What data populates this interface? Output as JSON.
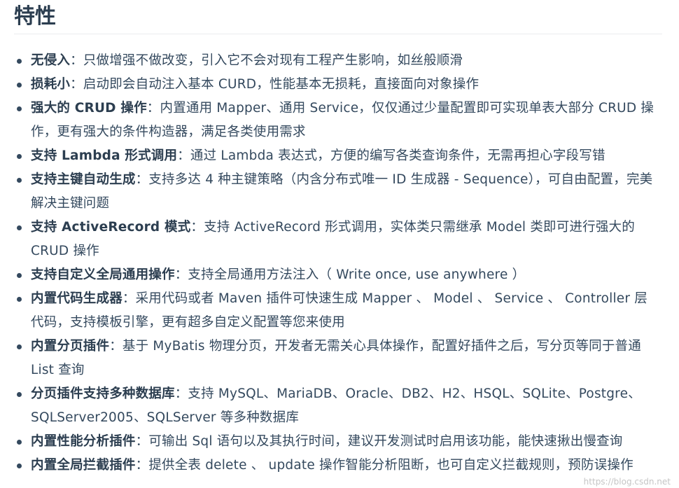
{
  "heading": "特性",
  "features": [
    {
      "name": "无侵入",
      "sep": "：",
      "desc": "只做增强不做改变，引入它不会对现有工程产生影响，如丝般顺滑"
    },
    {
      "name": "损耗小",
      "sep": "：",
      "desc": "启动即会自动注入基本 CURD，性能基本无损耗，直接面向对象操作"
    },
    {
      "name": "强大的 CRUD 操作",
      "sep": "：",
      "desc": "内置通用 Mapper、通用 Service，仅仅通过少量配置即可实现单表大部分 CRUD 操作，更有强大的条件构造器，满足各类使用需求"
    },
    {
      "name": "支持 Lambda 形式调用",
      "sep": "：",
      "desc": "通过 Lambda 表达式，方便的编写各类查询条件，无需再担心字段写错"
    },
    {
      "name": "支持主键自动生成",
      "sep": "：",
      "desc": "支持多达 4 种主键策略（内含分布式唯一 ID 生成器 - Sequence），可自由配置，完美解决主键问题"
    },
    {
      "name": "支持 ActiveRecord 模式",
      "sep": "：",
      "desc": "支持 ActiveRecord 形式调用，实体类只需继承 Model 类即可进行强大的 CRUD 操作"
    },
    {
      "name": "支持自定义全局通用操作",
      "sep": "：",
      "desc": "支持全局通用方法注入（ Write once, use anywhere ）"
    },
    {
      "name": "内置代码生成器",
      "sep": "：",
      "desc": "采用代码或者 Maven 插件可快速生成 Mapper 、 Model 、 Service 、 Controller 层代码，支持模板引擎，更有超多自定义配置等您来使用"
    },
    {
      "name": "内置分页插件",
      "sep": "：",
      "desc": "基于 MyBatis 物理分页，开发者无需关心具体操作，配置好插件之后，写分页等同于普通 List 查询"
    },
    {
      "name": "分页插件支持多种数据库",
      "sep": "：",
      "desc": "支持 MySQL、MariaDB、Oracle、DB2、H2、HSQL、SQLite、Postgre、SQLServer2005、SQLServer 等多种数据库"
    },
    {
      "name": "内置性能分析插件",
      "sep": "：",
      "desc": "可输出 Sql 语句以及其执行时间，建议开发测试时启用该功能，能快速揪出慢查询"
    },
    {
      "name": "内置全局拦截插件",
      "sep": "：",
      "desc": "提供全表 delete 、 update 操作智能分析阻断，也可自定义拦截规则，预防误操作"
    }
  ],
  "watermark": "https://blog.csdn.net"
}
